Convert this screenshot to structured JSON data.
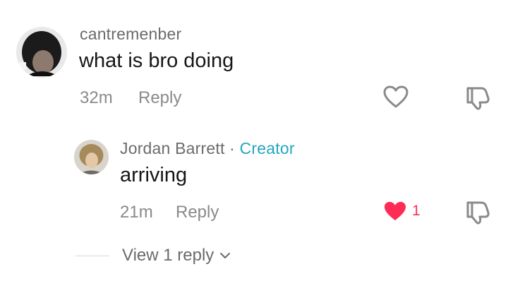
{
  "comment": {
    "username": "cantremenber",
    "text": "what is bro doing",
    "time": "32m",
    "reply_label": "Reply",
    "liked": false
  },
  "reply": {
    "username": "Jordan Barrett",
    "separator": "·",
    "creator_badge": "Creator",
    "text": "arriving",
    "time": "21m",
    "reply_label": "Reply",
    "liked": true,
    "like_count": "1"
  },
  "view_replies_label": "View 1 reply",
  "colors": {
    "creator": "#23a6bf",
    "like_active": "#fe2c55",
    "secondary_text": "#8a8a8a"
  }
}
